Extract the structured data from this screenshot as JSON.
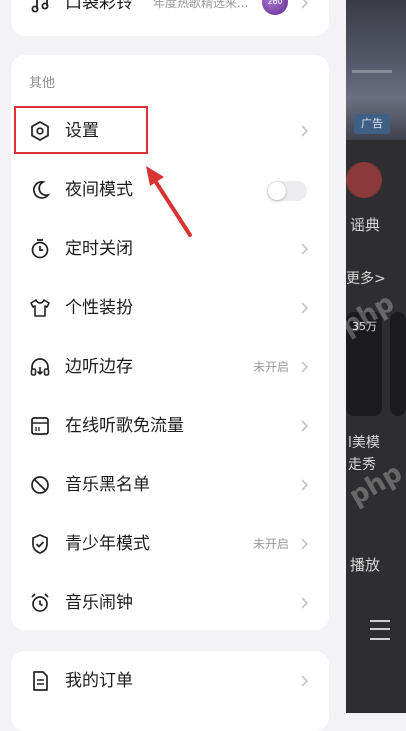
{
  "top_item": {
    "label": "口袋彩铃",
    "subtitle": "年度热歌精选来...",
    "icon": "music-note-icon"
  },
  "others_section": {
    "title": "其他",
    "items": [
      {
        "label": "设置",
        "icon": "hexagon-settings-icon",
        "status": ""
      },
      {
        "label": "夜间模式",
        "icon": "moon-icon",
        "status": "",
        "toggle": false
      },
      {
        "label": "定时关闭",
        "icon": "timer-icon",
        "status": ""
      },
      {
        "label": "个性装扮",
        "icon": "shirt-icon",
        "status": ""
      },
      {
        "label": "边听边存",
        "icon": "headphones-download-icon",
        "status": "未开启"
      },
      {
        "label": "在线听歌免流量",
        "icon": "sim-card-icon",
        "status": ""
      },
      {
        "label": "音乐黑名单",
        "icon": "block-icon",
        "status": ""
      },
      {
        "label": "青少年模式",
        "icon": "shield-check-icon",
        "status": "未开启"
      },
      {
        "label": "音乐闹钟",
        "icon": "alarm-clock-icon",
        "status": ""
      }
    ]
  },
  "bottom_item": {
    "label": "我的订单",
    "icon": "order-document-icon"
  },
  "background": {
    "ad_label": "广告",
    "text1": "谣典",
    "more_label": "更多>",
    "card_num": "35万",
    "card_caption1": "l美模",
    "card_caption2": "走秀",
    "play_label": "播放"
  },
  "colors": {
    "highlight": "#d93333",
    "card_bg": "#ffffff",
    "drawer_bg": "#f3f3f5"
  }
}
